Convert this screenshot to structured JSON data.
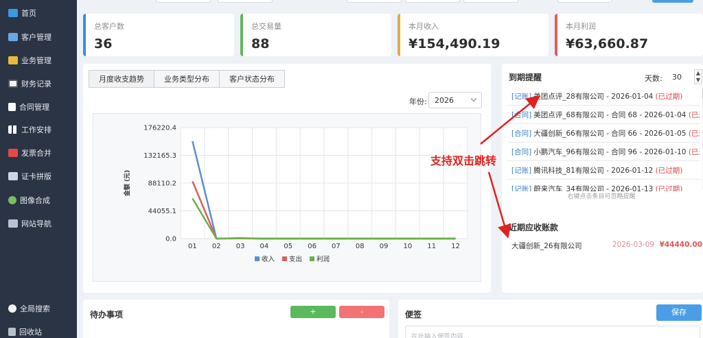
{
  "sidebar": {
    "items": [
      {
        "label": "首页",
        "icon": "home-icon"
      },
      {
        "label": "客户管理",
        "icon": "folder-icon"
      },
      {
        "label": "业务管理",
        "icon": "folder-icon"
      },
      {
        "label": "财务记录",
        "icon": "ledger-icon"
      },
      {
        "label": "合同管理",
        "icon": "document-icon"
      },
      {
        "label": "工作安排",
        "icon": "grid-icon"
      },
      {
        "label": "发票合并",
        "icon": "invoice-icon"
      },
      {
        "label": "证卡拼版",
        "icon": "id-card-icon"
      },
      {
        "label": "图像合成",
        "icon": "image-icon"
      },
      {
        "label": "网站导航",
        "icon": "navigation-icon"
      }
    ],
    "bottom_items": [
      {
        "label": "全局搜索",
        "icon": "search-icon"
      },
      {
        "label": "回收站",
        "icon": "recycle-bin-icon"
      }
    ]
  },
  "stats": [
    {
      "label": "总客户数",
      "value": "36",
      "color": "#3b8fd9"
    },
    {
      "label": "总交易量",
      "value": "88",
      "color": "#5cb85c"
    },
    {
      "label": "本月收入",
      "value": "¥154,490.19",
      "color": "#e8a845"
    },
    {
      "label": "本月利润",
      "value": "¥63,660.87",
      "color": "#e05d5d"
    }
  ],
  "chart_panel": {
    "tabs": [
      "月度收支趋势",
      "业务类型分布",
      "客户状态分布"
    ],
    "active_tab": 0,
    "year_label": "年份:",
    "year_value": "2026"
  },
  "chart_data": {
    "type": "line",
    "categories": [
      "01",
      "02",
      "03",
      "04",
      "05",
      "06",
      "07",
      "08",
      "09",
      "10",
      "11",
      "12"
    ],
    "ylabel": "金额 (元)",
    "ylim": [
      0,
      176220.4
    ],
    "yticks": [
      "176220.4",
      "132165.3",
      "88110.2",
      "44055.1",
      "0.0"
    ],
    "legend_position": "bottom",
    "grid": true,
    "series": [
      {
        "name": "收入",
        "color": "#5b8fd0",
        "values": [
          154490.19,
          0,
          800,
          0,
          0,
          0,
          0,
          0,
          0,
          0,
          0,
          0
        ]
      },
      {
        "name": "支出",
        "color": "#d9605d",
        "values": [
          90829.32,
          0,
          300,
          0,
          0,
          0,
          0,
          0,
          0,
          0,
          0,
          0
        ]
      },
      {
        "name": "利润",
        "color": "#6ab04c",
        "values": [
          63660.87,
          0,
          500,
          0,
          0,
          0,
          0,
          0,
          0,
          0,
          0,
          0
        ]
      }
    ]
  },
  "reminders": {
    "title": "到期提醒",
    "days_label": "天数:",
    "days_value": "30",
    "spin_up": "▲",
    "spin_down": "▼",
    "items": [
      {
        "tag": "[记账]",
        "text": "美团点评_28有限公司 - 2026-01-04",
        "status": "(已过期)"
      },
      {
        "tag": "[合同]",
        "text": "美团点评_68有限公司 - 合同 68 - 2026-01-04",
        "status": "(已过"
      },
      {
        "tag": "[合同]",
        "text": "大疆创新_66有限公司 - 合同 66 - 2026-01-05",
        "status": "(已过"
      },
      {
        "tag": "[合同]",
        "text": "小鹏汽车_96有限公司 - 合同 96 - 2026-01-10",
        "status": "(已过"
      },
      {
        "tag": "[记账]",
        "text": "腾讯科技_81有限公司 - 2026-01-12",
        "status": "(已过期)"
      },
      {
        "tag": "[记账]",
        "text": "蔚来汽车_34有限公司 - 2026-01-13",
        "status": "(已过期)"
      }
    ],
    "hint": "右键点击条目可忽略提醒"
  },
  "receivables": {
    "title": "近期应收账款",
    "items": [
      {
        "company": "大疆创新_26有限公司",
        "date": "2026-03-09",
        "amount": "¥44440.00"
      }
    ]
  },
  "todo": {
    "title": "待办事项",
    "add_label": "+",
    "remove_label": "-"
  },
  "notes": {
    "title": "便签",
    "save_label": "保存",
    "placeholder": "在此输入便签内容..."
  },
  "annotation": {
    "text": "支持双击跳转",
    "color": "#e02222"
  }
}
